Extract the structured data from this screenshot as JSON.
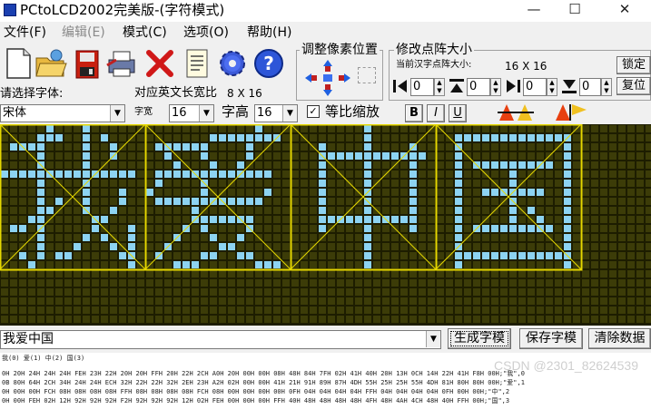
{
  "window": {
    "title": "PCtoLCD2002完美版-(字符模式)",
    "minimize_glyph": "—",
    "maximize_glyph": "☐",
    "close_glyph": "✕"
  },
  "menu": [
    {
      "label": "文件(F)",
      "enabled": true
    },
    {
      "label": "编辑(E)",
      "enabled": false
    },
    {
      "label": "模式(C)",
      "enabled": true
    },
    {
      "label": "选项(O)",
      "enabled": true
    },
    {
      "label": "帮助(H)",
      "enabled": true
    }
  ],
  "toolbar_icons": [
    "new-icon",
    "open-icon",
    "save-icon",
    "print-icon",
    "delete-icon",
    "document-icon",
    "settings-icon",
    "help-icon"
  ],
  "adjust_position": {
    "title": "调整像素位置"
  },
  "matrix_size": {
    "title": "修改点阵大小",
    "current_label": "当前汉字点阵大小:",
    "current_value": "16 X 16",
    "confirm_button": "锁定",
    "reset_button": "复位",
    "spin_values": [
      "0",
      "0",
      "0",
      "0"
    ]
  },
  "font_select": {
    "label": "请选择字体:",
    "value": "宋体"
  },
  "ascii_size": {
    "label": "对应英文长宽比",
    "value": "8 X 16"
  },
  "width": {
    "label": "字宽",
    "value": "16"
  },
  "height": {
    "label": "字高",
    "value": "16"
  },
  "proportional": {
    "label": "等比缩放",
    "checked": true
  },
  "style_buttons": [
    "B",
    "I",
    "U"
  ],
  "text_input": {
    "value": "我爱中国"
  },
  "actions": {
    "generate": "生成字模",
    "save": "保存字模",
    "clear": "清除数据"
  },
  "output": {
    "header": "我(0) 爱(1) 中(2) 国(3)",
    "lines": [
      "0H 20H 24H 24H 24H FEH 23H 22H 20H 20H FFH 20H 22H 2CH A0H 20H 00H 00H 08H 48H 84H 7FH 02H 41H 40H 20H 13H 0CH 14H 22H 41H F8H 00H;\"我\",0",
      "0B 80H 64H 2CH 34H 24H 24H ECH 32H 22H 22H 32H 2EH 23H A2H 02H 00H 00H 41H 21H 91H 89H 87H 4DH 55H 25H 25H 55H 4DH 81H 80H 80H 00H;\"爱\",1",
      "0H 00H 00H FCH 08H 08H 08H 08H FFH 08H 08H 08H 08H FCH 08H 00H 00H 00H 00H 0FH 04H 04H 04H 04H FFH 04H 04H 04H 04H 0FH 00H 00H;\"中\",2",
      "0H 00H FEH 02H 12H 92H 92H 92H F2H 92H 92H 92H 12H 02H FEH 00H 00H 00H FFH 40H 48H 48H 48H 48H 4FH 48H 4AH 4CH 48H 40H FFH 00H;\"国\",3"
    ]
  },
  "watermark": "CSDN @2301_82624539",
  "colors": {
    "canvas_bg": "#1d1d00",
    "pixel_off": "#3c3c08",
    "pixel_on": "#8dd3f2",
    "char_box": "#e6d800",
    "grid_line": "#101000"
  }
}
